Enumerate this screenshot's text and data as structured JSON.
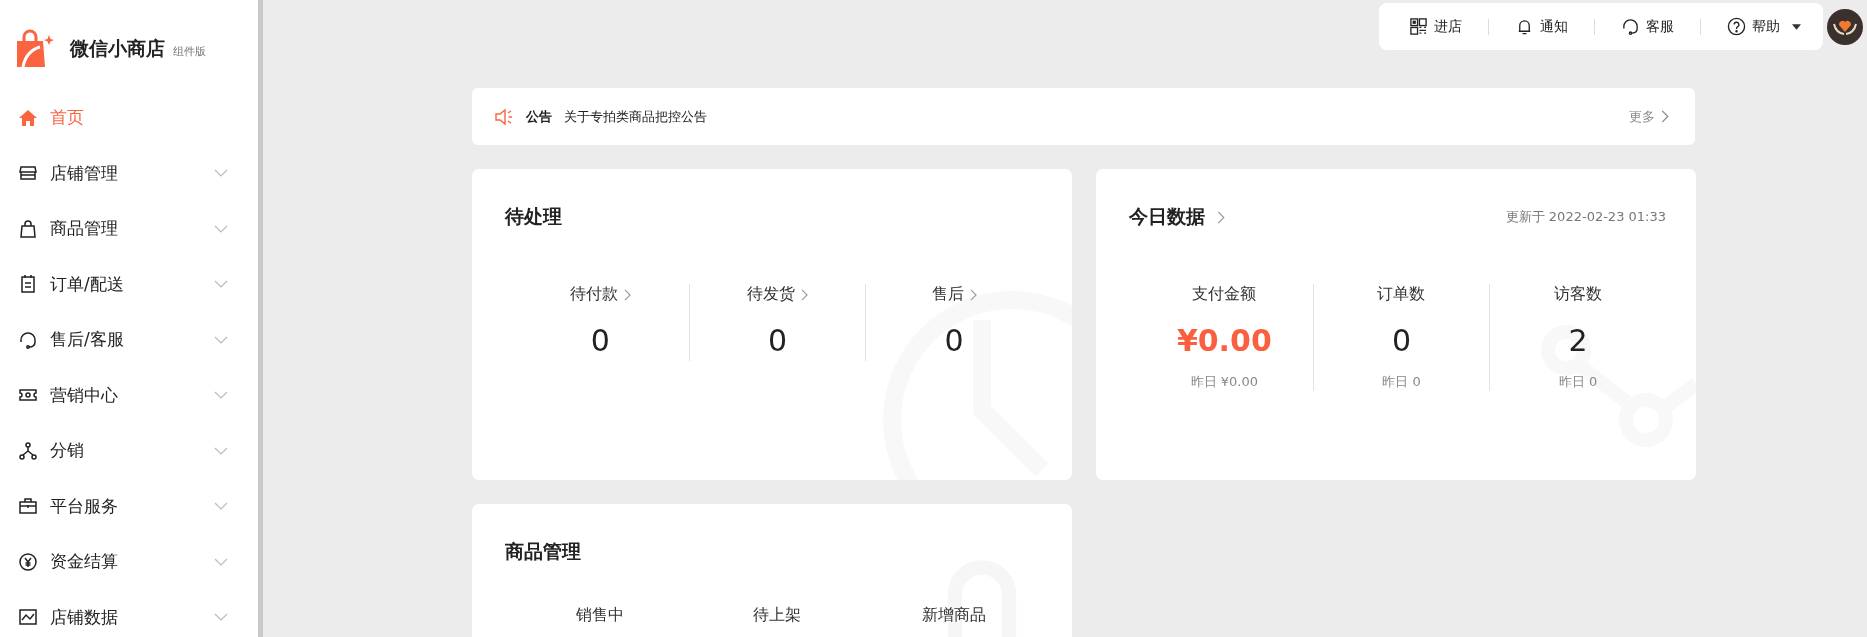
{
  "brand": {
    "name": "微信小商店",
    "edition": "组件版"
  },
  "nav": [
    {
      "label": "首页",
      "selected": true,
      "expandable": false
    },
    {
      "label": "店铺管理",
      "selected": false,
      "expandable": true
    },
    {
      "label": "商品管理",
      "selected": false,
      "expandable": true
    },
    {
      "label": "订单/配送",
      "selected": false,
      "expandable": true
    },
    {
      "label": "售后/客服",
      "selected": false,
      "expandable": true
    },
    {
      "label": "营销中心",
      "selected": false,
      "expandable": true
    },
    {
      "label": "分销",
      "selected": false,
      "expandable": true
    },
    {
      "label": "平台服务",
      "selected": false,
      "expandable": true
    },
    {
      "label": "资金结算",
      "selected": false,
      "expandable": true
    },
    {
      "label": "店铺数据",
      "selected": false,
      "expandable": true
    }
  ],
  "topbar": [
    {
      "label": "进店",
      "dropdown": false
    },
    {
      "label": "通知",
      "dropdown": false
    },
    {
      "label": "客服",
      "dropdown": false
    },
    {
      "label": "帮助",
      "dropdown": true
    }
  ],
  "notice": {
    "tag": "公告",
    "text": "关于专拍类商品把控公告",
    "more": "更多"
  },
  "pending": {
    "title": "待处理",
    "items": [
      {
        "label": "待付款",
        "value": "0"
      },
      {
        "label": "待发货",
        "value": "0"
      },
      {
        "label": "售后",
        "value": "0"
      }
    ]
  },
  "today": {
    "title": "今日数据",
    "updated": "更新于 2022-02-23 01:33",
    "items": [
      {
        "label": "支付金额",
        "value": "¥0.00",
        "highlight": true,
        "yesterday": "昨日 ¥0.00"
      },
      {
        "label": "订单数",
        "value": "0",
        "highlight": false,
        "yesterday": "昨日 0"
      },
      {
        "label": "访客数",
        "value": "2",
        "highlight": false,
        "yesterday": "昨日 0"
      }
    ]
  },
  "goods": {
    "title": "商品管理",
    "items": [
      {
        "label": "销售中"
      },
      {
        "label": "待上架"
      },
      {
        "label": "新增商品"
      }
    ]
  }
}
